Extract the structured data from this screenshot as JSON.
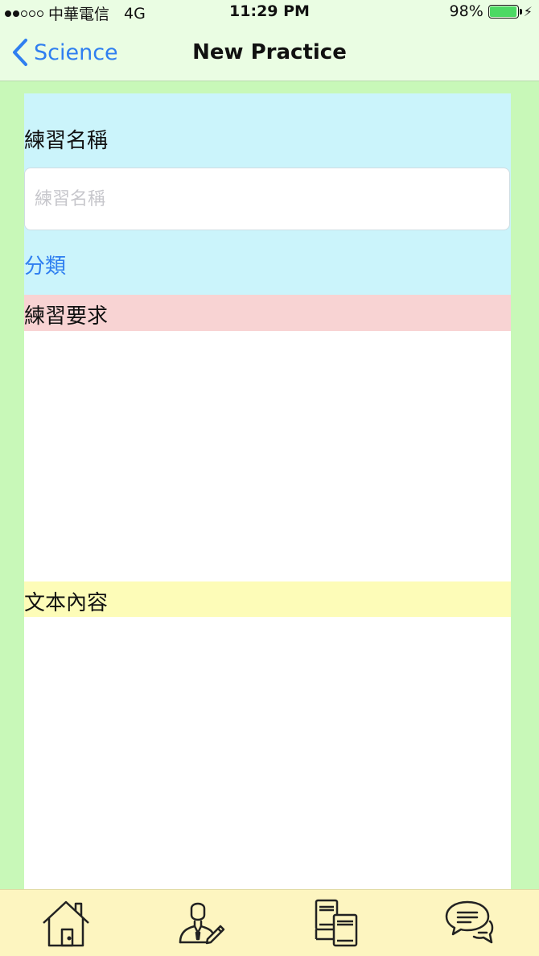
{
  "status_bar": {
    "carrier": "中華電信",
    "network": "4G",
    "time": "11:29 PM",
    "battery_text": "98%",
    "battery_level": 0.98,
    "signal_bars_filled": 2,
    "signal_bars_total": 5
  },
  "nav": {
    "back_label": "Science",
    "title": "New Practice"
  },
  "form": {
    "name_label": "練習名稱",
    "name_placeholder": "練習名稱",
    "name_value": "",
    "category_label": "分類",
    "requirement_label": "練習要求",
    "text_content_label": "文本內容"
  },
  "tab_bar": {
    "tabs": [
      {
        "icon": "home-icon"
      },
      {
        "icon": "teacher-icon"
      },
      {
        "icon": "books-icon"
      },
      {
        "icon": "chat-icon"
      }
    ]
  },
  "colors": {
    "background": "#c8f8b8",
    "bar_background": "#eafde3",
    "accent_blue": "#2f7ff0",
    "name_section": "#cbf4fb",
    "requirement_header": "#f8d3d3",
    "text_header": "#fdfcb8",
    "tab_bar": "#fdf5c0",
    "battery": "#4cd964"
  }
}
